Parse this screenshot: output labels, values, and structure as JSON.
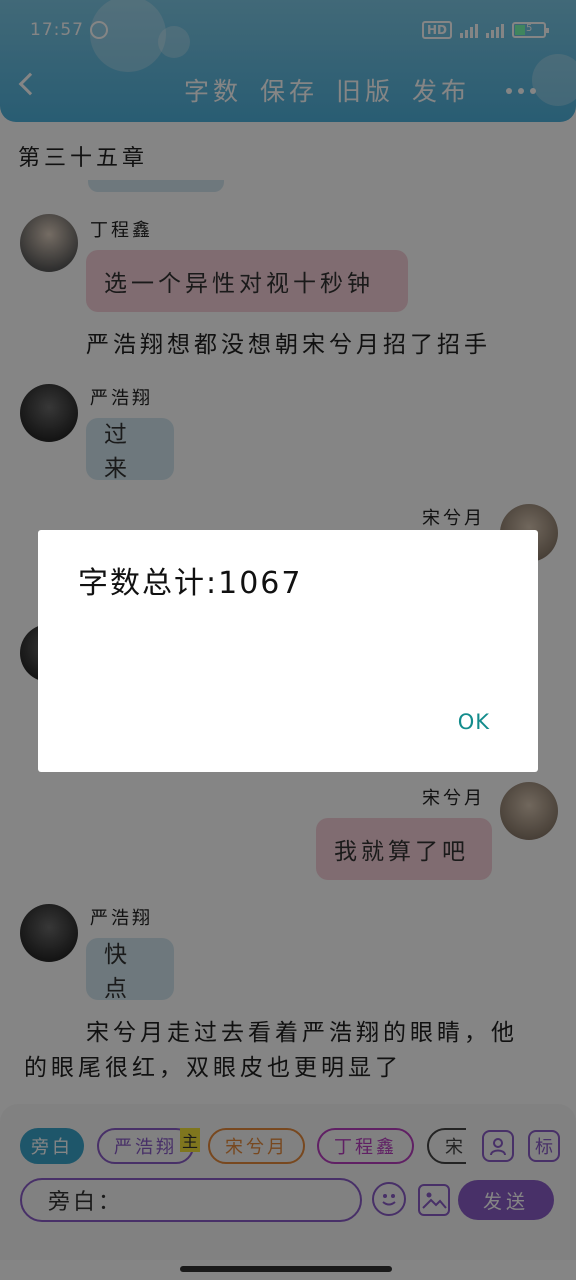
{
  "status": {
    "time": "17:57",
    "hd": "HD",
    "battery": "5"
  },
  "toolbar": {
    "word_count": "字数",
    "save": "保存",
    "old_version": "旧版",
    "publish": "发布"
  },
  "chapter": {
    "title": "第三十五章"
  },
  "messages": {
    "m1_name": "丁程鑫",
    "m1_text": "选一个异性对视十秒钟",
    "narr1": "严浩翔想都没想朝宋兮月招了招手",
    "m2_name": "严浩翔",
    "m2_text": "过来",
    "m3_name": "宋兮月",
    "m4_name": "宋兮月",
    "m4_text": "我就算了吧",
    "m5_name": "严浩翔",
    "m5_text": "快点",
    "narr2_line1": "宋兮月走过去看着严浩翔的眼睛，他",
    "narr2_line2": "的眼尾很红，双眼皮也更明显了"
  },
  "roles": {
    "narrator": "旁白",
    "yan": "严浩翔",
    "main_tag": "主",
    "song": "宋兮月",
    "ding": "丁程鑫",
    "more": "宋",
    "tag_label": "标"
  },
  "input": {
    "value": "旁白：",
    "send": "发送"
  },
  "dialog": {
    "message": "字数总计:1067",
    "ok": "OK"
  },
  "colors": {
    "header": "#4fb2dc",
    "accent": "#8a5cc8",
    "narrator_chip": "#3aa6cc",
    "ok": "#138c8c"
  }
}
